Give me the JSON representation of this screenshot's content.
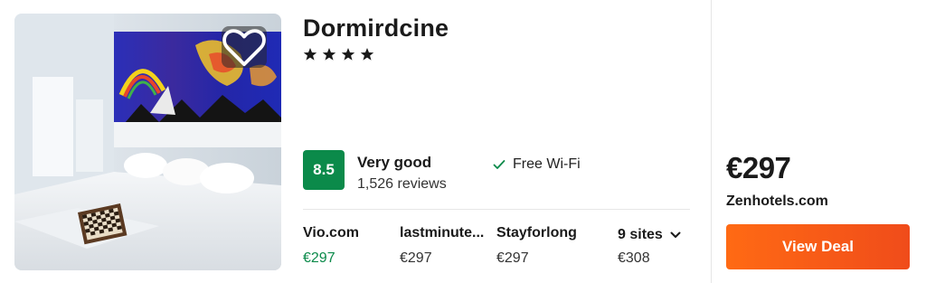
{
  "hotel": {
    "name": "Dormirdcine",
    "stars": 4,
    "photo_icon": "hotel-room-photo",
    "favorite_icon": "heart-outline-icon"
  },
  "rating": {
    "score": "8.5",
    "label": "Very good",
    "reviews": "1,526 reviews",
    "color": "#0b8a4a"
  },
  "amenities": [
    {
      "label": "Free Wi-Fi",
      "icon": "check-icon"
    }
  ],
  "providers": [
    {
      "name": "Vio.com",
      "price": "€297",
      "best": true
    },
    {
      "name": "lastminute...",
      "price": "€297",
      "best": false
    },
    {
      "name": "Stayforlong",
      "price": "€297",
      "best": false
    }
  ],
  "more_sites": {
    "label": "9 sites",
    "price": "€308",
    "icon": "chevron-down-icon"
  },
  "deal": {
    "price": "€297",
    "site": "Zenhotels.com",
    "button_label": "View Deal",
    "button_color": "#f45b18"
  }
}
